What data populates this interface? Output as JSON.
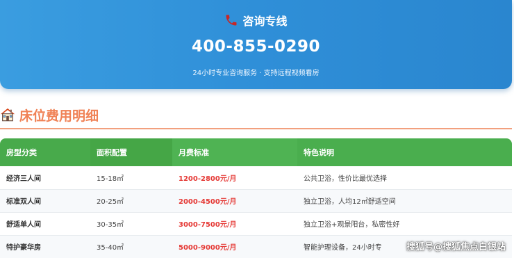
{
  "hotline": {
    "icon": "phone-icon",
    "title": "咨询专线",
    "number": "400-855-0290",
    "description": "24小时专业咨询服务 · 支持远程视频看房"
  },
  "section": {
    "icon": "house-icon",
    "title": "床位费用明细",
    "accent_color": "#f08256"
  },
  "table": {
    "headers": [
      "房型分类",
      "面积配置",
      "月费标准",
      "特色说明"
    ],
    "rows": [
      {
        "type": "经济三人间",
        "area": "15-18㎡",
        "price": "1200-2800元/月",
        "feature": "公共卫浴，性价比最优选择"
      },
      {
        "type": "标准双人间",
        "area": "20-25㎡",
        "price": "2000-4500元/月",
        "feature": "独立卫浴，人均12㎡舒适空间"
      },
      {
        "type": "舒适单人间",
        "area": "30-35㎡",
        "price": "3000-7500元/月",
        "feature": "独立卫浴+观景阳台，私密性好"
      },
      {
        "type": "特护豪华房",
        "area": "35-40㎡",
        "price": "5000-9000元/月",
        "feature": "智能护理设备，24小时专"
      }
    ],
    "header_color": "#4caf50",
    "price_color": "#e53935"
  },
  "watermark": "搜狐号@搜狐焦点白银站"
}
